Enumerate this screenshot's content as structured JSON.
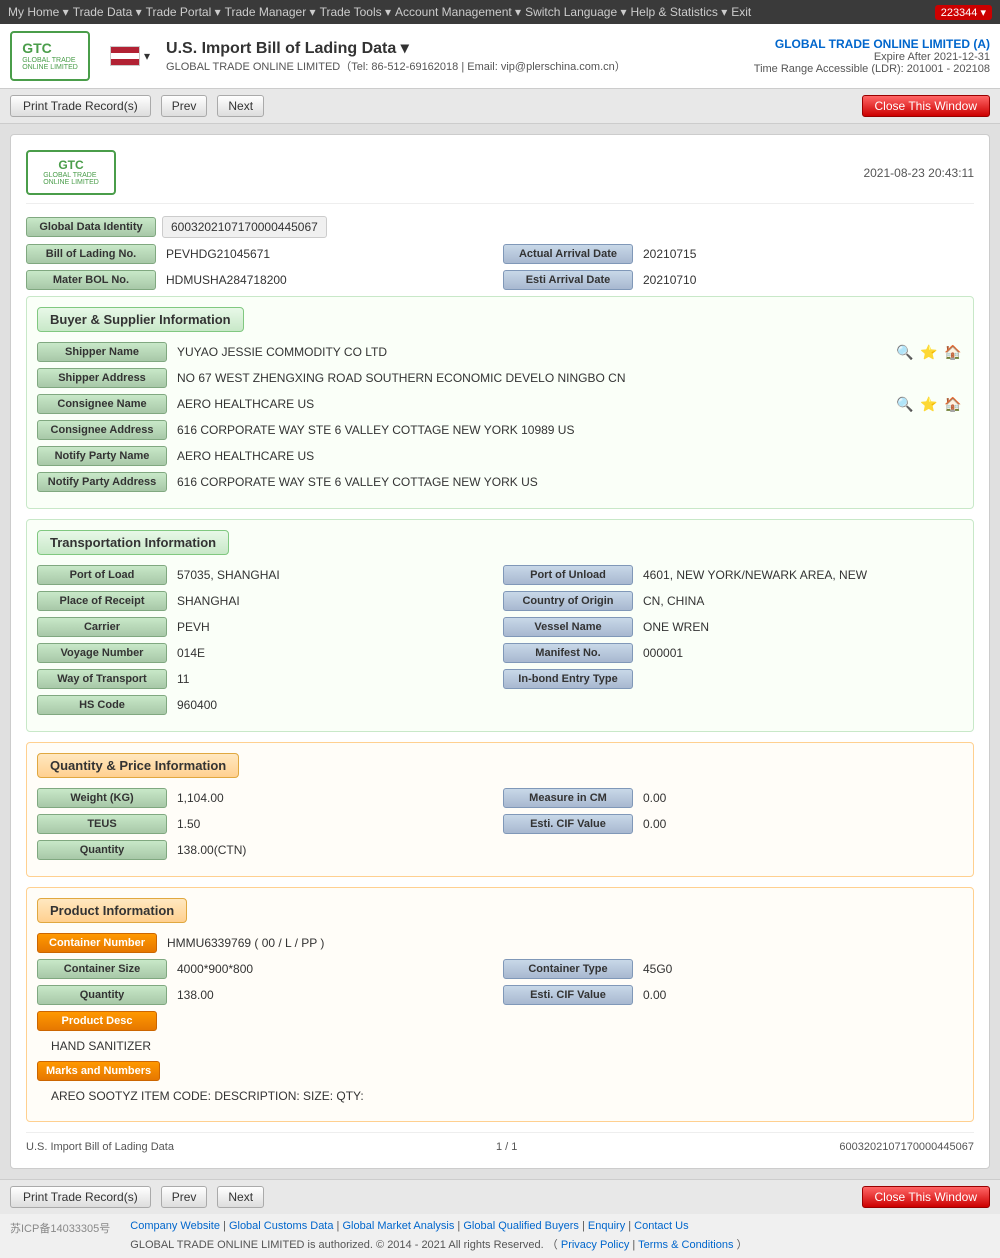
{
  "nav": {
    "items": [
      {
        "label": "My Home ▾"
      },
      {
        "label": "Trade Data ▾"
      },
      {
        "label": "Trade Portal ▾"
      },
      {
        "label": "Trade Manager ▾"
      },
      {
        "label": "Trade Tools ▾"
      },
      {
        "label": "Account Management ▾"
      },
      {
        "label": "Switch Language ▾"
      },
      {
        "label": "Help & Statistics ▾"
      },
      {
        "label": "Exit"
      }
    ],
    "badge": "223344 ▾"
  },
  "header": {
    "logo_line1": "GTC",
    "logo_line2": "GLOBAL TRADE",
    "logo_line3": "ONLINE LIMITED",
    "page_title": "U.S. Import Bill of Lading Data ▾",
    "subtitle": "GLOBAL TRADE ONLINE LIMITED（Tel: 86-512-69162018 | Email: vip@plerschina.com.cn）",
    "company_name": "GLOBAL TRADE ONLINE LIMITED (A)",
    "expire_label": "Expire After 2021-12-31",
    "time_range": "Time Range Accessible (LDR): 201001 - 202108"
  },
  "action_bar": {
    "print_btn": "Print Trade Record(s)",
    "prev_btn": "Prev",
    "next_btn": "Next",
    "close_btn": "Close This Window"
  },
  "card": {
    "timestamp": "2021-08-23 20:43:11",
    "global_data_id_label": "Global Data Identity",
    "global_data_id_value": "6003202107170000445067",
    "bol_no_label": "Bill of Lading No.",
    "bol_no_value": "PEVHDG21045671",
    "actual_arrival_label": "Actual Arrival Date",
    "actual_arrival_value": "20210715",
    "master_bol_label": "Mater BOL No.",
    "master_bol_value": "HDMUSHA284718200",
    "esti_arrival_label": "Esti Arrival Date",
    "esti_arrival_value": "20210710"
  },
  "buyer_supplier": {
    "section_title": "Buyer & Supplier Information",
    "shipper_name_label": "Shipper Name",
    "shipper_name_value": "YUYAO JESSIE COMMODITY CO LTD",
    "shipper_address_label": "Shipper Address",
    "shipper_address_value": "NO 67 WEST ZHENGXING ROAD SOUTHERN ECONOMIC DEVELO NINGBO CN",
    "consignee_name_label": "Consignee Name",
    "consignee_name_value": "AERO HEALTHCARE US",
    "consignee_address_label": "Consignee Address",
    "consignee_address_value": "616 CORPORATE WAY STE 6 VALLEY COTTAGE NEW YORK 10989 US",
    "notify_party_name_label": "Notify Party Name",
    "notify_party_name_value": "AERO HEALTHCARE US",
    "notify_party_address_label": "Notify Party Address",
    "notify_party_address_value": "616 CORPORATE WAY STE 6 VALLEY COTTAGE NEW YORK US"
  },
  "transportation": {
    "section_title": "Transportation Information",
    "port_of_load_label": "Port of Load",
    "port_of_load_value": "57035, SHANGHAI",
    "port_of_unload_label": "Port of Unload",
    "port_of_unload_value": "4601, NEW YORK/NEWARK AREA, NEW",
    "place_of_receipt_label": "Place of Receipt",
    "place_of_receipt_value": "SHANGHAI",
    "country_of_origin_label": "Country of Origin",
    "country_of_origin_value": "CN, CHINA",
    "carrier_label": "Carrier",
    "carrier_value": "PEVH",
    "vessel_name_label": "Vessel Name",
    "vessel_name_value": "ONE WREN",
    "voyage_number_label": "Voyage Number",
    "voyage_number_value": "014E",
    "manifest_no_label": "Manifest No.",
    "manifest_no_value": "000001",
    "way_of_transport_label": "Way of Transport",
    "way_of_transport_value": "11",
    "in_bond_entry_label": "In-bond Entry Type",
    "in_bond_entry_value": "",
    "hs_code_label": "HS Code",
    "hs_code_value": "960400"
  },
  "quantity_price": {
    "section_title": "Quantity & Price Information",
    "weight_label": "Weight (KG)",
    "weight_value": "1,104.00",
    "measure_cm_label": "Measure in CM",
    "measure_cm_value": "0.00",
    "teus_label": "TEUS",
    "teus_value": "1.50",
    "esti_cif_label": "Esti. CIF Value",
    "esti_cif_value": "0.00",
    "quantity_label": "Quantity",
    "quantity_value": "138.00(CTN)"
  },
  "product_info": {
    "section_title": "Product Information",
    "container_number_label": "Container Number",
    "container_number_value": "HMMU6339769 ( 00 / L / PP )",
    "container_size_label": "Container Size",
    "container_size_value": "4000*900*800",
    "container_type_label": "Container Type",
    "container_type_value": "45G0",
    "quantity_label": "Quantity",
    "quantity_value": "138.00",
    "esti_cif_label": "Esti. CIF Value",
    "esti_cif_value": "0.00",
    "product_desc_label": "Product Desc",
    "product_desc_value": "HAND SANITIZER",
    "marks_numbers_label": "Marks and Numbers",
    "marks_numbers_value": "AREO SOOTYZ ITEM CODE: DESCRIPTION: SIZE: QTY:"
  },
  "card_footer": {
    "footer_label": "U.S. Import Bill of Lading Data",
    "page_info": "1 / 1",
    "record_id": "6003202107170000445067"
  },
  "bottom_action_bar": {
    "print_btn": "Print Trade Record(s)",
    "prev_btn": "Prev",
    "next_btn": "Next",
    "close_btn": "Close This Window"
  },
  "footer": {
    "icp": "苏ICP备14033305号",
    "links": [
      {
        "label": "Company Website"
      },
      {
        "label": "Global Customs Data"
      },
      {
        "label": "Global Market Analysis"
      },
      {
        "label": "Global Qualified Buyers"
      },
      {
        "label": "Enquiry"
      },
      {
        "label": "Contact Us"
      }
    ],
    "copyright": "GLOBAL TRADE ONLINE LIMITED is authorized. © 2014 - 2021 All rights Reserved.",
    "privacy_policy": "Privacy Policy",
    "terms": "Terms & Conditions"
  }
}
